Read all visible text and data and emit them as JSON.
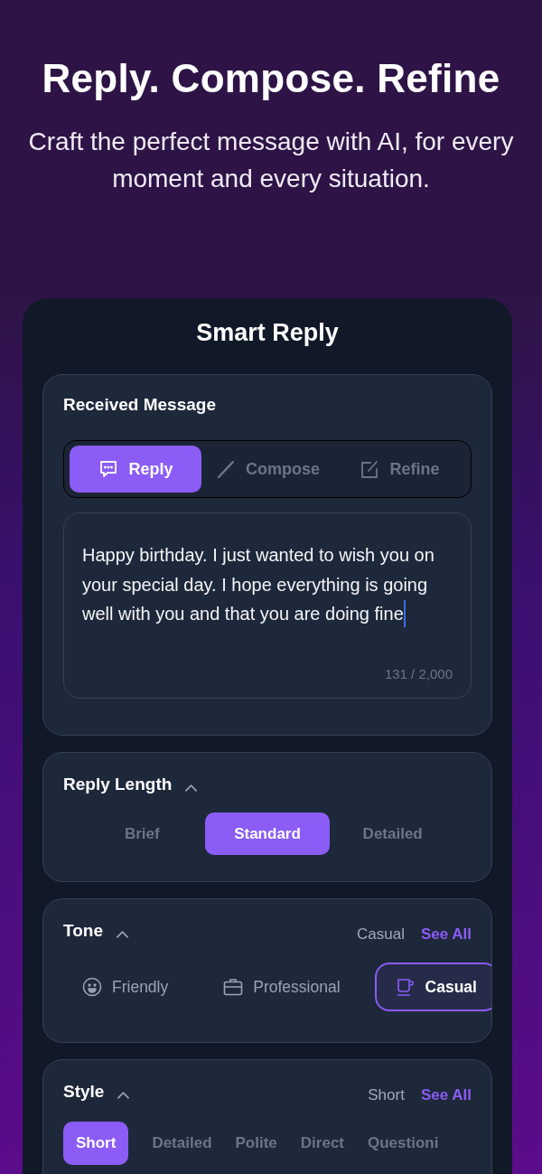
{
  "hero": {
    "title": "Reply. Compose. Refine",
    "subtitle": "Craft the perfect message with AI, for every moment and every situation."
  },
  "card": {
    "title": "Smart Reply"
  },
  "received": {
    "title": "Received Message",
    "modes": [
      {
        "label": "Reply",
        "kind": "chat",
        "selected": true
      },
      {
        "label": "Compose",
        "kind": "pen",
        "selected": false
      },
      {
        "label": "Refine",
        "kind": "edit",
        "selected": false
      }
    ],
    "message": {
      "value": "Happy birthday. I just wanted to wish you on your special day. I hope everything is going well with you and that you are doing fine",
      "counter": "131 / 2,000"
    }
  },
  "length": {
    "title": "Reply Length",
    "expanded": true,
    "options": [
      {
        "label": "Brief",
        "selected": false
      },
      {
        "label": "Standard",
        "selected": true
      },
      {
        "label": "Detailed",
        "selected": false
      }
    ]
  },
  "tone": {
    "title": "Tone",
    "expanded": true,
    "current": "Casual",
    "see_all": "See All",
    "options": [
      {
        "label": "Friendly",
        "kind": "smile",
        "selected": false
      },
      {
        "label": "Professional",
        "kind": "briefcase",
        "selected": false
      },
      {
        "label": "Casual",
        "kind": "cup",
        "selected": true
      }
    ]
  },
  "style": {
    "title": "Style",
    "expanded": true,
    "current": "Short",
    "see_all": "See All",
    "options": [
      {
        "label": "Short",
        "selected": true
      },
      {
        "label": "Detailed",
        "selected": false
      },
      {
        "label": "Polite",
        "selected": false
      },
      {
        "label": "Direct",
        "selected": false
      },
      {
        "label": "Questioni",
        "selected": false
      }
    ]
  }
}
